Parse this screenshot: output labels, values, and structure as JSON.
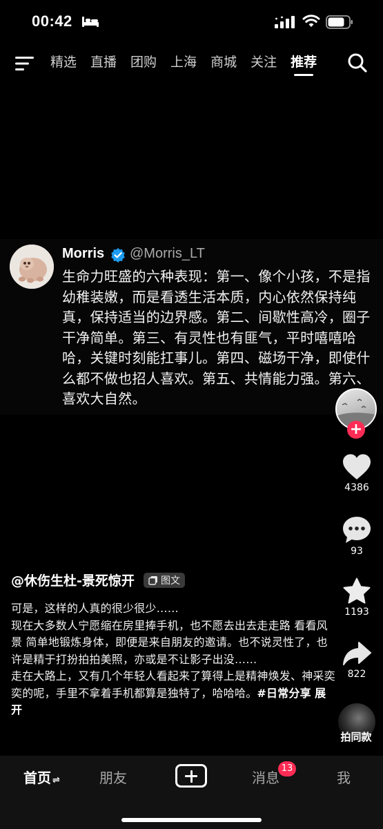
{
  "status_bar": {
    "time": "00:42"
  },
  "top_nav": {
    "tabs": [
      {
        "label": "精选"
      },
      {
        "label": "直播"
      },
      {
        "label": "团购"
      },
      {
        "label": "上海"
      },
      {
        "label": "商城"
      },
      {
        "label": "关注"
      },
      {
        "label": "推荐",
        "active": true
      }
    ]
  },
  "tweet": {
    "name": "Morris",
    "handle": "@Morris_LT",
    "body": "生命力旺盛的六种表现：第一、像个小孩，不是指幼稚装嫩，而是看透生活本质，内心依然保持纯真，保持适当的边界感。第二、间歇性高冷，圈子干净简单。第三、有灵性也有匪气，平时嘻嘻哈哈，关键时刻能扛事儿。第四、磁场干净，即使什么都不做也招人喜欢。第五、共情能力强。第六、喜欢大自然。"
  },
  "right_rail": {
    "follow_symbol": "+",
    "likes": "4386",
    "comments": "93",
    "favorites": "1193",
    "shares": "822"
  },
  "caption": {
    "author": "@休伤生杜-景死惊开",
    "post_type": "图文",
    "lines": [
      "可是，这样的人真的很少很少……",
      "现在大多数人宁愿缩在房里捧手机，也不愿去出去走走路 看看风景 简单地锻炼身体，即便是来自朋友的邀请。也不说灵性了，也许是精于打扮拍拍美照，亦或是不让影子出没……",
      "走在大路上，又有几个年轻人看起来了算得上是精神焕发、神采奕奕的呢，手里不拿着手机都算是独特了，哈哈哈。"
    ],
    "hashtag": "#日常分享",
    "expand": "展开"
  },
  "music": {
    "label": "拍同款"
  },
  "bottom_nav": {
    "home": "首页",
    "home_swap": "⇌",
    "friends": "朋友",
    "messages": "消息",
    "messages_badge": "13",
    "me": "我"
  },
  "colors": {
    "accent": "#fe2c55",
    "verified": "#1d9bf0",
    "background": "#000000"
  }
}
